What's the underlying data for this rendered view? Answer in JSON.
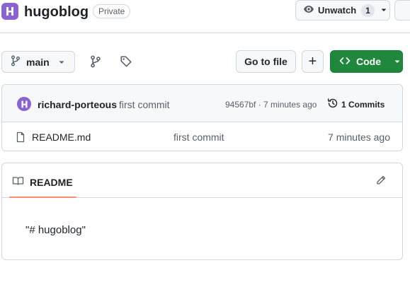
{
  "repo": {
    "name": "hugoblog",
    "visibility": "Private"
  },
  "watch": {
    "label": "Unwatch",
    "count": "1"
  },
  "toolbar": {
    "branch": "main",
    "go_to_file": "Go to file",
    "add": "+",
    "code": "Code"
  },
  "commit": {
    "author": "richard-porteous",
    "message": "first commit",
    "sha_time": "94567bf · 7 minutes ago",
    "commits_label": "1 Commits"
  },
  "files": [
    {
      "name": "README.md",
      "message": "first commit",
      "age": "7 minutes ago"
    }
  ],
  "readme": {
    "tab": "README",
    "content": "\"# hugoblog\""
  },
  "colors": {
    "accent_green": "#1f883d",
    "tab_underline": "#fd8c73",
    "avatar_purple": "#8a63d2"
  }
}
